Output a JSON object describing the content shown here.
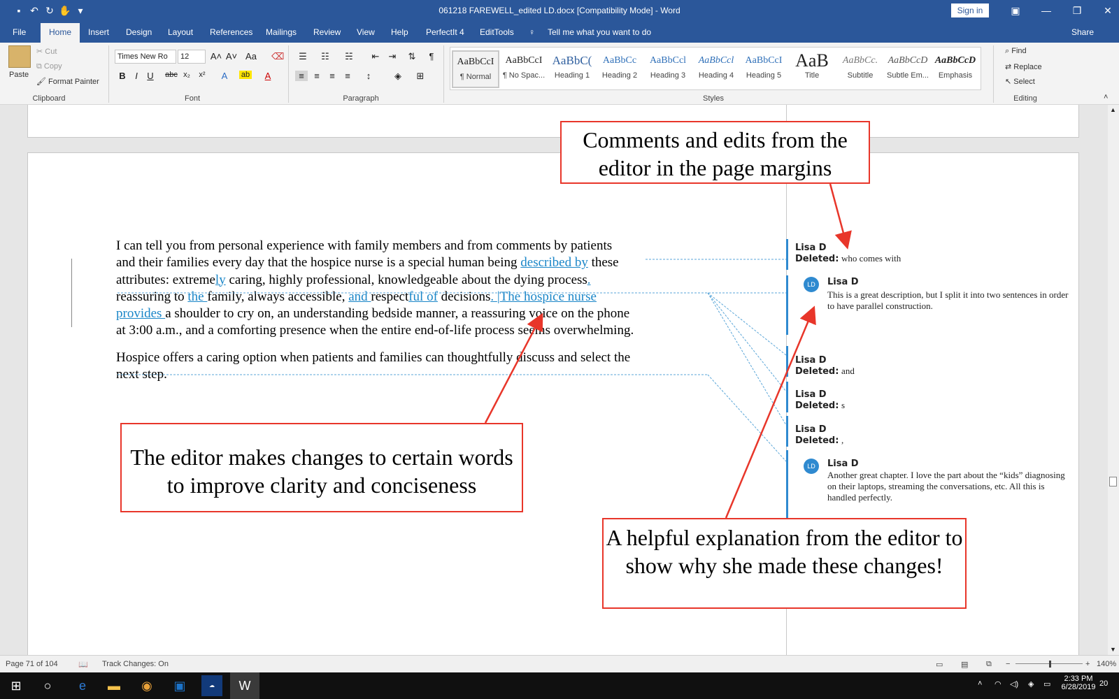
{
  "window": {
    "title": "061218 FAREWELL_edited LD.docx [Compatibility Mode]  -  Word",
    "signin": "Sign in"
  },
  "tabs": [
    "File",
    "Home",
    "Insert",
    "Design",
    "Layout",
    "References",
    "Mailings",
    "Review",
    "View",
    "Help",
    "PerfectIt 4",
    "EditTools"
  ],
  "tellme": "Tell me what you want to do",
  "share": "Share",
  "ribbon": {
    "paste": "Paste",
    "cut": "Cut",
    "copy": "Copy",
    "format_painter": "Format Painter",
    "clipboard": "Clipboard",
    "font_name": "Times New Ro",
    "font_size": "12",
    "font": "Font",
    "paragraph": "Paragraph",
    "styles_label": "Styles",
    "editing": "Editing",
    "find": "Find",
    "replace": "Replace",
    "select": "Select",
    "styles": [
      {
        "preview": "AaBbCcI",
        "label": "¶ Normal"
      },
      {
        "preview": "AaBbCcI",
        "label": "¶ No Spac..."
      },
      {
        "preview": "AaBbC(",
        "label": "Heading 1"
      },
      {
        "preview": "AaBbCc",
        "label": "Heading 2"
      },
      {
        "preview": "AaBbCcl",
        "label": "Heading 3"
      },
      {
        "preview": "AaBbCcl",
        "label": "Heading 4"
      },
      {
        "preview": "AaBbCcI",
        "label": "Heading 5"
      },
      {
        "preview": "AaB",
        "label": "Title"
      },
      {
        "preview": "AaBbCc.",
        "label": "Subtitle"
      },
      {
        "preview": "AaBbCcD",
        "label": "Subtle Em..."
      },
      {
        "preview": "AaBbCcD",
        "label": "Emphasis"
      }
    ]
  },
  "document": {
    "p1": [
      {
        "t": "I can tell you from personal experience with family members and from comments by patients",
        "ins": false
      },
      {
        "t": "and their families every day that the hospice nurse is a special human being ",
        "ins": false
      },
      {
        "t": "described by",
        "ins": true
      },
      {
        "t": " these",
        "ins": false
      },
      {
        "t": "attributes: extreme",
        "ins": false
      },
      {
        "t": "ly",
        "ins": true
      },
      {
        "t": " caring, highly professional, knowledgeable about the dying process",
        "ins": false
      },
      {
        "t": ".",
        "ins": true
      },
      {
        "t": "reassuring to ",
        "ins": false
      },
      {
        "t": "the ",
        "ins": true
      },
      {
        "t": "family, always accessible, ",
        "ins": false
      },
      {
        "t": "and ",
        "ins": true
      },
      {
        "t": "respect",
        "ins": false
      },
      {
        "t": "ful of",
        "ins": true
      },
      {
        "t": " decisions",
        "ins": false
      },
      {
        "t": ". ",
        "ins": true
      },
      {
        "t": "The hospice nurse",
        "ins": true
      },
      {
        "t": "provides ",
        "ins": true
      },
      {
        "t": "a shoulder to cry on, an understanding bedside manner, a reassuring voice on the phone",
        "ins": false
      },
      {
        "t": "at 3:00 a.m., and a comforting presence when the entire end-of-life process seems overwhelming.",
        "ins": false
      }
    ],
    "p2_line1": "Hospice offers a caring option when patients and families can thoughtfully discuss and select the",
    "p2_line2": "next step."
  },
  "balloons": {
    "deleted_label": "Deleted:",
    "b1": {
      "author": "Lisa D",
      "text": "who comes with"
    },
    "c1": {
      "author": "Lisa D",
      "initials": "LD",
      "text": "This is a great description, but I split it into two sentences in order to have parallel construction."
    },
    "b2": {
      "author": "Lisa D",
      "text": "and"
    },
    "b3": {
      "author": "Lisa D",
      "text": "s"
    },
    "b4": {
      "author": "Lisa D",
      "text": ","
    },
    "c2": {
      "author": "Lisa D",
      "initials": "LD",
      "text": "Another great chapter. I love the part about the “kids” diagnosing on their laptops, streaming the conversations, etc. All this is handled perfectly."
    }
  },
  "callouts": {
    "top": "Comments and edits from the editor in the page margins",
    "left": "The editor makes changes to certain words to improve clarity and conciseness",
    "bottom": "A helpful explanation from the editor to show why she made these changes!"
  },
  "status": {
    "page": "Page 71 of 104",
    "track": "Track Changes: On",
    "zoom": "140%"
  },
  "taskbar": {
    "time": "2:33 PM",
    "date": "6/28/2019",
    "notifications": "20"
  },
  "colors": {
    "word_blue": "#2b579a",
    "insert_blue": "#1a86c8",
    "callout_red": "#e8362a"
  }
}
